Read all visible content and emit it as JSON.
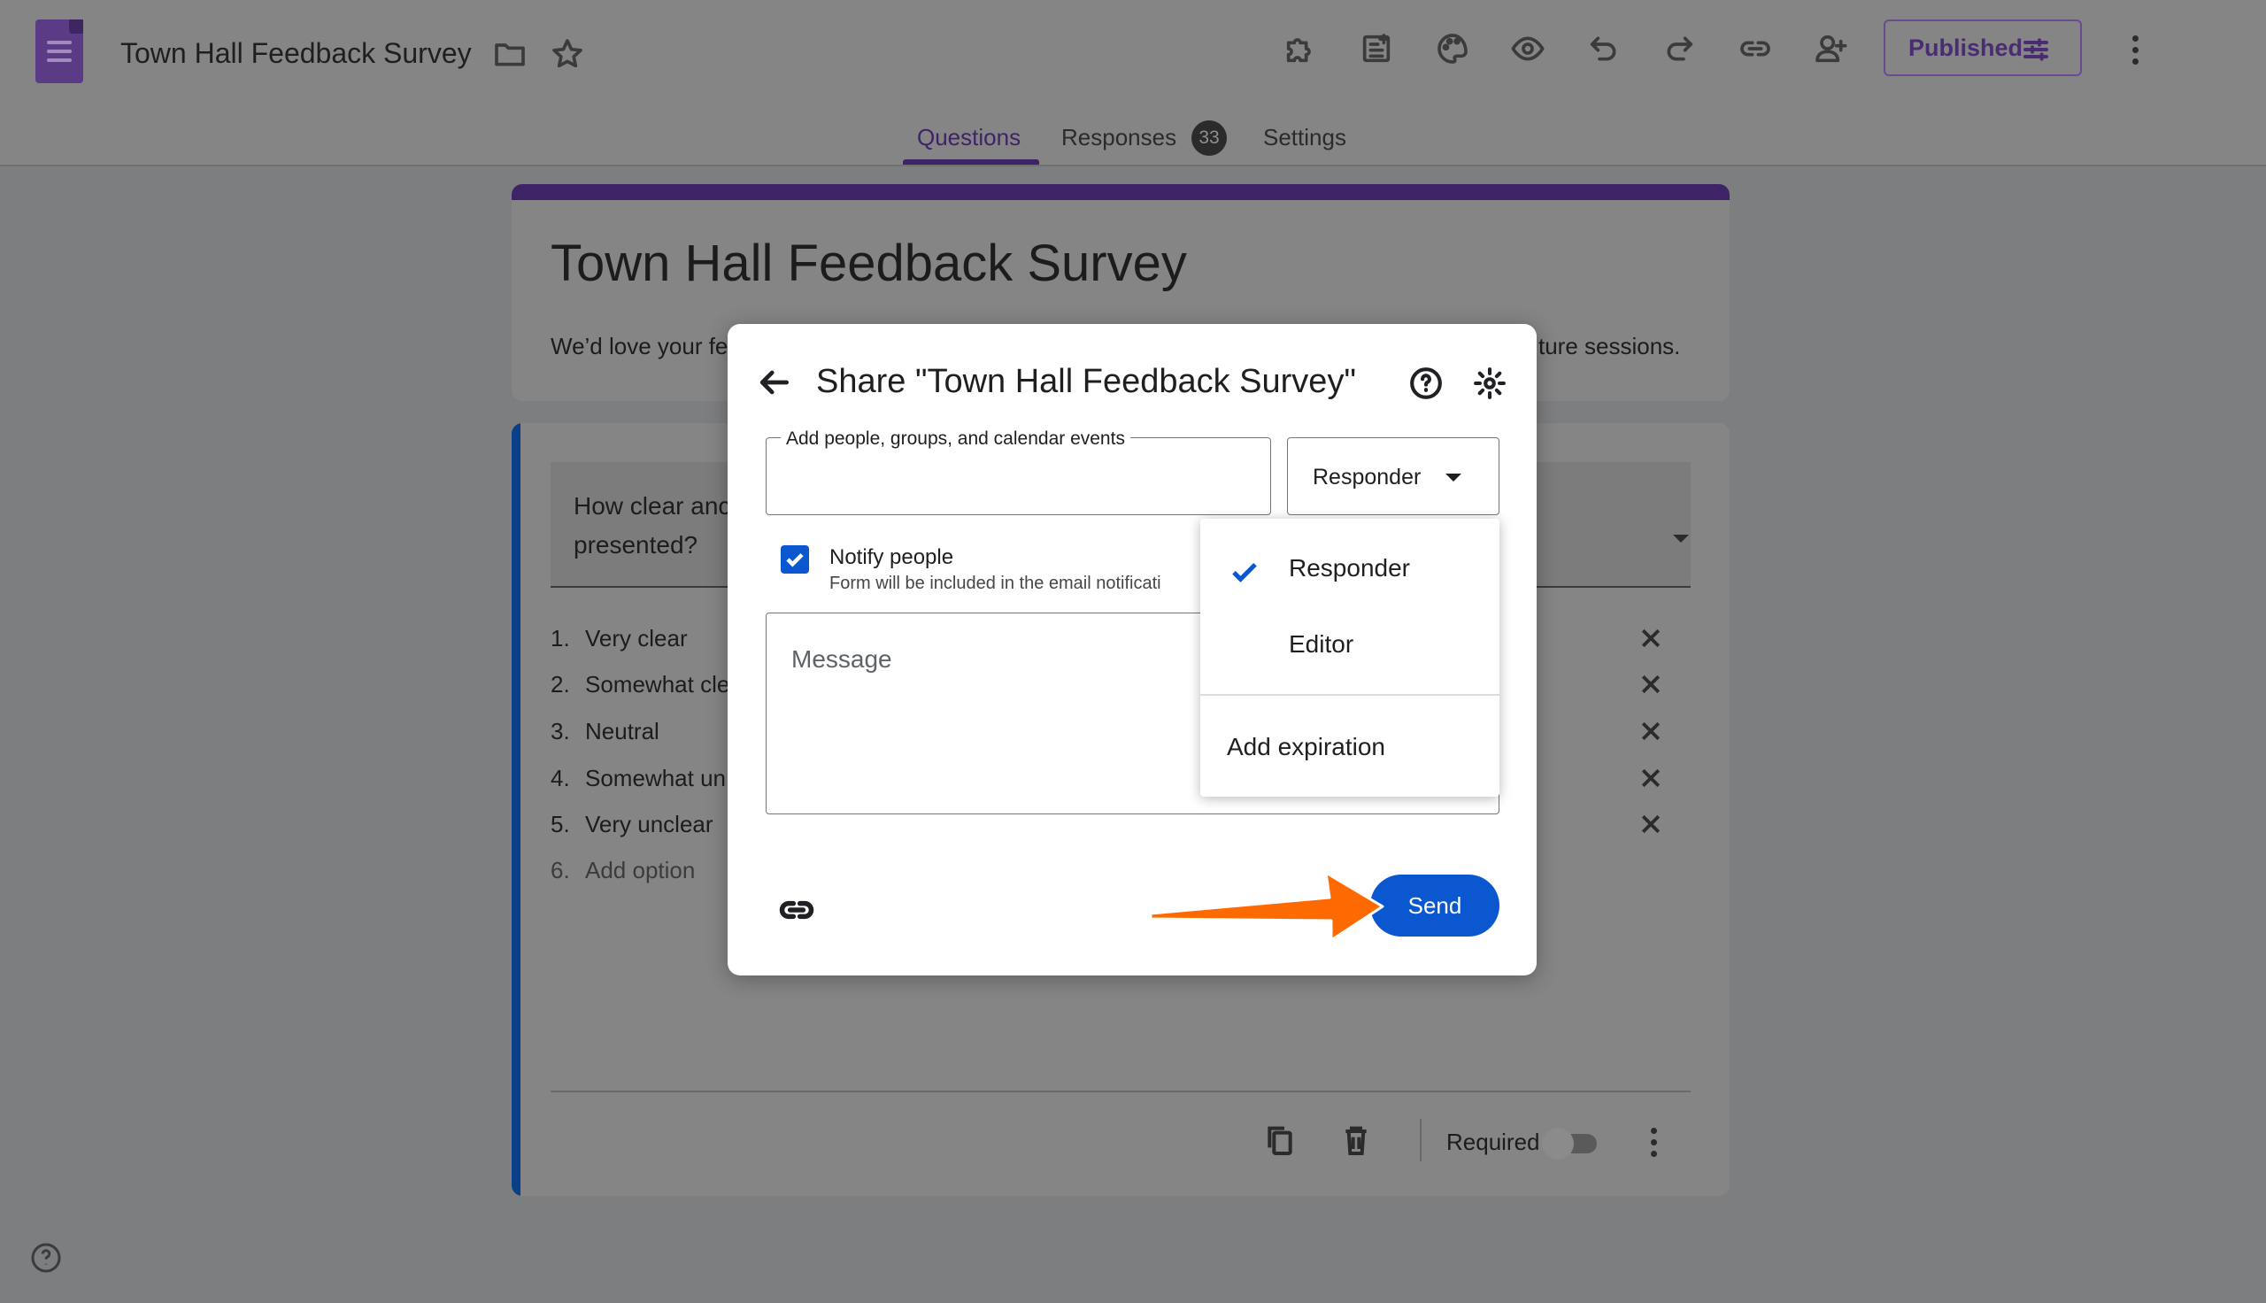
{
  "app": {
    "doc_title": "Town Hall Feedback Survey",
    "published_label": "Published"
  },
  "icons": {
    "folder": "folder-icon",
    "star": "star-icon",
    "addons": "puzzle-icon",
    "import": "import-questions-icon",
    "palette": "palette-icon",
    "preview": "eye-icon",
    "undo": "undo-icon",
    "redo": "redo-icon",
    "link": "link-icon",
    "collaborators": "add-person-icon",
    "more": "more-vert-icon"
  },
  "tabs": [
    {
      "label": "Questions",
      "active": true
    },
    {
      "label": "Responses",
      "badge": "33"
    },
    {
      "label": "Settings"
    }
  ],
  "form": {
    "title": "Town Hall Feedback Survey",
    "description_left": "We’d love your fe",
    "description_right": "ture sessions.",
    "question": "How clear and presented?",
    "question_line1": "How clear anc",
    "question_line2": "presented?",
    "options": [
      {
        "num": "1.",
        "label": "Very clear"
      },
      {
        "num": "2.",
        "label": "Somewhat cle"
      },
      {
        "num": "3.",
        "label": "Neutral"
      },
      {
        "num": "4.",
        "label": "Somewhat un"
      },
      {
        "num": "5.",
        "label": "Very unclear"
      }
    ],
    "add_option": {
      "num": "6.",
      "label": "Add option"
    },
    "required_label": "Required",
    "required_on": false
  },
  "share_dialog": {
    "title": "Share \"Town Hall Feedback Survey\"",
    "people_field_label": "Add people, groups, and calendar events",
    "people_field_value": "",
    "role_value": "Responder",
    "notify_checked": true,
    "notify_label": "Notify people",
    "notify_sub": "Form will be included in the email notificati",
    "message_placeholder": "Message",
    "send_label": "Send"
  },
  "role_menu": {
    "items": [
      {
        "label": "Responder",
        "selected": true
      },
      {
        "label": "Editor",
        "selected": false
      }
    ],
    "expiration_label": "Add expiration"
  },
  "colors": {
    "brand": "#673ab7",
    "primary_button": "#0b57d0",
    "annotation_arrow": "#ff6a00"
  }
}
